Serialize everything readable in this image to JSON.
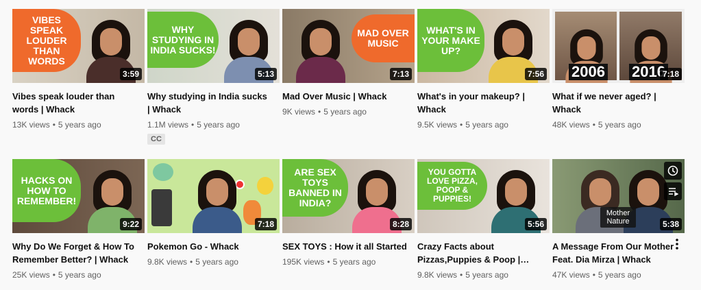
{
  "videos": [
    {
      "title": "Vibes speak louder than words | Whack",
      "views": "13K views",
      "age": "5 years ago",
      "duration": "3:59",
      "thumb_text": "VIBES SPEAK LOUDER THAN WORDS"
    },
    {
      "title": "Why studying in India sucks | Whack",
      "views": "1.1M views",
      "age": "5 years ago",
      "duration": "5:13",
      "thumb_text": "WHY STUDYING IN INDIA SUCKS!",
      "badge": "CC"
    },
    {
      "title": "Mad Over Music | Whack",
      "views": "9K views",
      "age": "5 years ago",
      "duration": "7:13",
      "thumb_text": "MAD OVER MUSIC"
    },
    {
      "title": "What's in your makeup? | Whack",
      "views": "9.5K views",
      "age": "5 years ago",
      "duration": "7:56",
      "thumb_text": "WHAT'S IN YOUR MAKE UP?"
    },
    {
      "title": "What if we never aged? | Whack",
      "views": "48K views",
      "age": "5 years ago",
      "duration": "7:18",
      "thumb_years": [
        "2006",
        "2016"
      ]
    },
    {
      "title": "Why Do We Forget & How To Remember Better? | Whack",
      "views": "25K views",
      "age": "5 years ago",
      "duration": "9:22",
      "thumb_text": "HACKS ON HOW TO REMEMBER!"
    },
    {
      "title": "Pokemon Go - Whack",
      "views": "9.8K views",
      "age": "5 years ago",
      "duration": "7:18"
    },
    {
      "title": "SEX TOYS : How it all Started",
      "views": "195K views",
      "age": "5 years ago",
      "duration": "8:28",
      "thumb_text": "ARE SEX TOYS BANNED IN INDIA?"
    },
    {
      "title": "Crazy Facts about Pizzas,Puppies & Poop | Whack",
      "views": "9.8K views",
      "age": "5 years ago",
      "duration": "5:56",
      "thumb_text": "YOU GOTTA LOVE PIZZA, POOP & PUPPIES!"
    },
    {
      "title": "A Message From Our Mother Feat. Dia Mirza | Whack",
      "views": "47K views",
      "age": "5 years ago",
      "duration": "5:38",
      "thumb_text": "Mother Nature"
    }
  ],
  "colors": {
    "orange": "#ef6a2c",
    "green": "#6cbf3a",
    "meta": "#606060"
  },
  "icons": {
    "watch_later": "clock-icon",
    "add_to_queue": "queue-icon",
    "more": "more-vert-icon"
  }
}
